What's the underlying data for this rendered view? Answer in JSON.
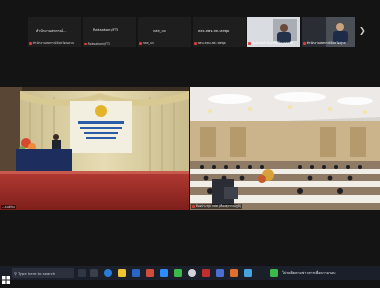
{
  "participants": [
    {
      "name": "สำนักงานสหกรณ์...",
      "sub": "สำนักงานสหกรณ์จังหวัดนครน"
    },
    {
      "name": "Raksakorn/FTI",
      "sub": "Raksakorn/FTI"
    },
    {
      "name": "กสส_บจ",
      "sub": "กสส_บจ"
    },
    {
      "name": "สสจ.สพจ.สส.:สสพุด",
      "sub": "สสบ.ลพบ.สส.:สสพุต"
    }
  ],
  "video_participants": [
    {
      "name": "ศูนย์เขตสำนักงานบริการสารส"
    },
    {
      "name": "สำนักงานสหกรณ์จังหวัดสุรส"
    }
  ],
  "main_panes": [
    {
      "label": "...sukhu"
    },
    {
      "label": "ห้องประชุม กสส (ห้องสุวรรณภูมิ)"
    }
  ],
  "taskbar": {
    "search_placeholder": "Type here to search",
    "status_text": "โปรดติดตามข่าวสารเพื่อความรอบ"
  },
  "colors": {
    "mic_muted": "#e03a3a",
    "taskbar": "#1b1f29",
    "background": "#141414"
  }
}
